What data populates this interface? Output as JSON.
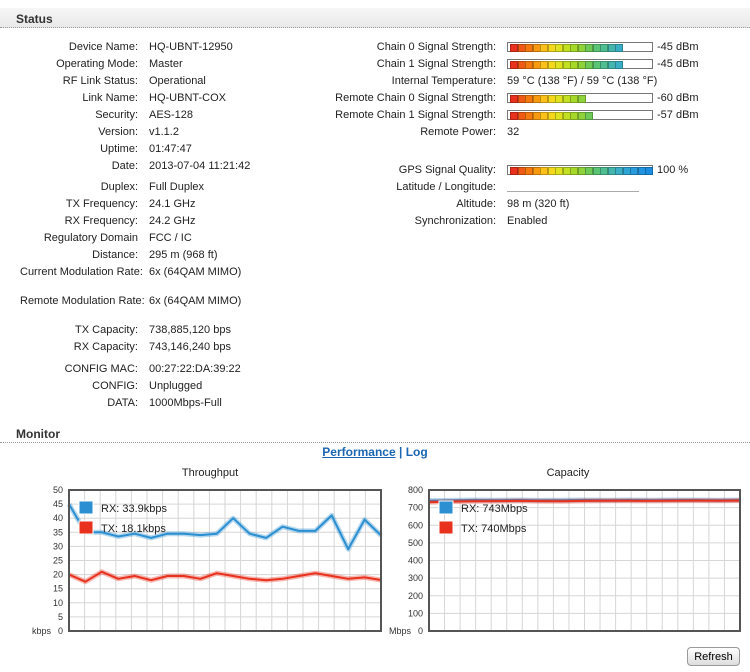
{
  "status": {
    "title": "Status",
    "left": [
      {
        "label": "Device Name:",
        "value": "HQ-UBNT-12950"
      },
      {
        "label": "Operating Mode:",
        "value": "Master"
      },
      {
        "label": "RF Link Status:",
        "value": "Operational"
      },
      {
        "label": "Link Name:",
        "value": "HQ-UBNT-COX"
      },
      {
        "label": "Security:",
        "value": "AES-128"
      },
      {
        "label": "Version:",
        "value": "v1.1.2"
      },
      {
        "label": "Uptime:",
        "value": "01:47:47"
      },
      {
        "label": "Date:",
        "value": "2013-07-04 11:21:42"
      },
      {
        "label": "Duplex:",
        "value": "Full Duplex"
      },
      {
        "label": "TX Frequency:",
        "value": "24.1 GHz"
      },
      {
        "label": "RX Frequency:",
        "value": "24.2 GHz"
      },
      {
        "label": "Regulatory Domain",
        "value": "FCC / IC"
      },
      {
        "label": "Distance:",
        "value": "295 m (968 ft)"
      },
      {
        "label": "Current Modulation Rate:",
        "value": "6x (64QAM MIMO)"
      },
      {
        "label": "Remote Modulation Rate:",
        "value": "6x (64QAM MIMO)"
      },
      {
        "label": "TX Capacity:",
        "value": "738,885,120 bps"
      },
      {
        "label": "RX Capacity:",
        "value": "743,146,240 bps"
      },
      {
        "label": "CONFIG MAC:",
        "value": "00:27:22:DA:39:22"
      },
      {
        "label": "CONFIG:",
        "value": "Unplugged"
      },
      {
        "label": "DATA:",
        "value": "1000Mbps-Full"
      }
    ],
    "right": [
      {
        "label": "Chain 0 Signal Strength:",
        "value": "-45 dBm",
        "level": 0.78
      },
      {
        "label": "Chain 1 Signal Strength:",
        "value": "-45 dBm",
        "level": 0.78
      },
      {
        "label": "Internal Temperature:",
        "value": "59 °C (138 °F) / 59 °C (138 °F)"
      },
      {
        "label": "Remote Chain 0 Signal Strength:",
        "value": "-60 dBm",
        "level": 0.5
      },
      {
        "label": "Remote Chain 1 Signal Strength:",
        "value": "-57 dBm",
        "level": 0.56
      },
      {
        "label": "Remote Power:",
        "value": "32"
      },
      {
        "label": "GPS Signal Quality:",
        "value": "100 %",
        "level": 1.0
      },
      {
        "label": "Latitude / Longitude:",
        "value": ""
      },
      {
        "label": "Altitude:",
        "value": "98 m (320 ft)"
      },
      {
        "label": "Synchronization:",
        "value": "Enabled"
      }
    ]
  },
  "monitor": {
    "title": "Monitor",
    "links": {
      "performance": "Performance",
      "separator": "|",
      "log": "Log"
    }
  },
  "charts": {
    "throughput": {
      "title": "Throughput",
      "unit": "kbps"
    },
    "capacity": {
      "title": "Capacity",
      "unit": "Mbps"
    }
  },
  "chart_data": [
    {
      "type": "line",
      "title": "Throughput",
      "ylabel": "kbps",
      "ylim": [
        0,
        50
      ],
      "yticks": [
        0,
        5,
        10,
        15,
        20,
        25,
        30,
        35,
        40,
        45,
        50
      ],
      "grid": true,
      "legend": "top-left",
      "series": [
        {
          "name": "RX: 33.9kbps",
          "color": "#2b8fd1",
          "values": [
            45,
            35,
            35,
            33.5,
            34.5,
            33,
            34.5,
            34.5,
            34,
            34.5,
            40,
            34.5,
            33,
            37,
            35.5,
            35.5,
            41,
            29,
            39.5,
            33.9
          ]
        },
        {
          "name": "TX: 18.1kbps",
          "color": "#e8321e",
          "values": [
            20,
            17.5,
            21,
            18.5,
            19.5,
            18,
            19.5,
            19.5,
            18.5,
            20.5,
            19.5,
            18.5,
            18,
            18.5,
            19.5,
            20.5,
            19.5,
            18.5,
            19,
            18.1
          ]
        }
      ]
    },
    {
      "type": "line",
      "title": "Capacity",
      "ylabel": "Mbps",
      "ylim": [
        0,
        800
      ],
      "yticks": [
        0,
        100,
        200,
        300,
        400,
        500,
        600,
        700,
        800
      ],
      "grid": true,
      "legend": "top-left",
      "series": [
        {
          "name": "RX: 743Mbps",
          "color": "#2b8fd1",
          "values": [
            740,
            741,
            743,
            742,
            743,
            741,
            742,
            743,
            742,
            743,
            742,
            743,
            743,
            742,
            743
          ]
        },
        {
          "name": "TX: 740Mbps",
          "color": "#e8321e",
          "values": [
            730,
            734,
            736,
            737,
            738,
            737,
            736,
            738,
            739,
            739,
            738,
            739,
            740,
            739,
            740
          ]
        }
      ]
    }
  ],
  "buttons": {
    "refresh": "Refresh"
  }
}
